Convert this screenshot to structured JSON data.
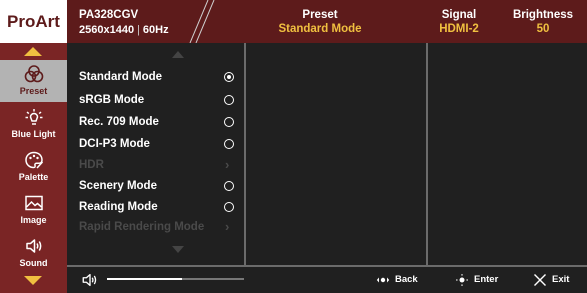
{
  "header": {
    "logo": "ProArt",
    "model": "PA328CGV",
    "resolution": "2560x1440",
    "refresh": "60Hz",
    "preset": {
      "title": "Preset",
      "value": "Standard Mode"
    },
    "signal": {
      "title": "Signal",
      "value": "HDMI-2"
    },
    "brightness": {
      "title": "Brightness",
      "value": "50"
    }
  },
  "nav": {
    "items": [
      {
        "label": "Preset",
        "icon": "preset-icon",
        "active": true
      },
      {
        "label": "Blue Light",
        "icon": "blue-light-icon",
        "active": false
      },
      {
        "label": "Palette",
        "icon": "palette-icon",
        "active": false
      },
      {
        "label": "Image",
        "icon": "image-icon",
        "active": false
      },
      {
        "label": "Sound",
        "icon": "sound-icon",
        "active": false
      }
    ]
  },
  "modes": [
    {
      "label": "Standard Mode",
      "control": "radio",
      "selected": true,
      "enabled": true
    },
    {
      "label": "sRGB Mode",
      "control": "radio",
      "selected": false,
      "enabled": true
    },
    {
      "label": "Rec. 709 Mode",
      "control": "radio",
      "selected": false,
      "enabled": true
    },
    {
      "label": "DCI-P3 Mode",
      "control": "radio",
      "selected": false,
      "enabled": true
    },
    {
      "label": "HDR",
      "control": "chevron",
      "selected": false,
      "enabled": false
    },
    {
      "label": "Scenery Mode",
      "control": "radio",
      "selected": false,
      "enabled": true
    },
    {
      "label": "Reading Mode",
      "control": "radio",
      "selected": false,
      "enabled": true
    },
    {
      "label": "Rapid Rendering Mode",
      "control": "chevron",
      "selected": false,
      "enabled": false
    }
  ],
  "footer": {
    "volume_level": 0.55,
    "back_label": "Back",
    "enter_label": "Enter",
    "exit_label": "Exit"
  },
  "colors": {
    "brand": "#5d1b1b",
    "nav_bg": "#7a2525",
    "accent": "#f0c040",
    "panel_bg": "#202020"
  }
}
